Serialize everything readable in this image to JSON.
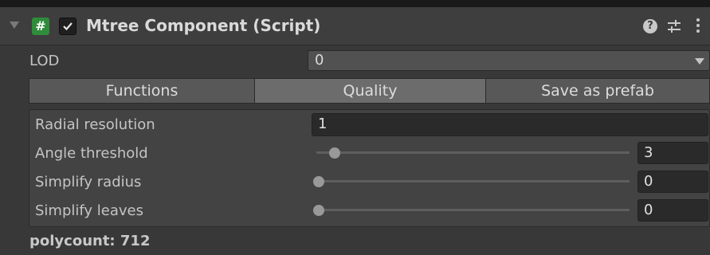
{
  "header": {
    "script_glyph": "#",
    "title": "Mtree Component (Script)",
    "help_glyph": "?"
  },
  "lod": {
    "label": "LOD",
    "value": "0"
  },
  "tabs": [
    {
      "label": "Functions",
      "selected": false
    },
    {
      "label": "Quality",
      "selected": true
    },
    {
      "label": "Save as prefab",
      "selected": false
    }
  ],
  "settings": {
    "radial_resolution": {
      "label": "Radial resolution",
      "value": "1"
    },
    "angle_threshold": {
      "label": "Angle threshold",
      "value": "3",
      "slider_fraction": 0.05
    },
    "simplify_radius": {
      "label": "Simplify radius",
      "value": "0",
      "slider_fraction": 0.0
    },
    "simplify_leaves": {
      "label": "Simplify leaves",
      "value": "0",
      "slider_fraction": 0.0
    }
  },
  "footer": {
    "polycount": "polycount: 712"
  },
  "colors": {
    "script_icon": "#2f8c3a",
    "panel_bg": "#383838",
    "tab_selected": "#6c6c6c"
  }
}
